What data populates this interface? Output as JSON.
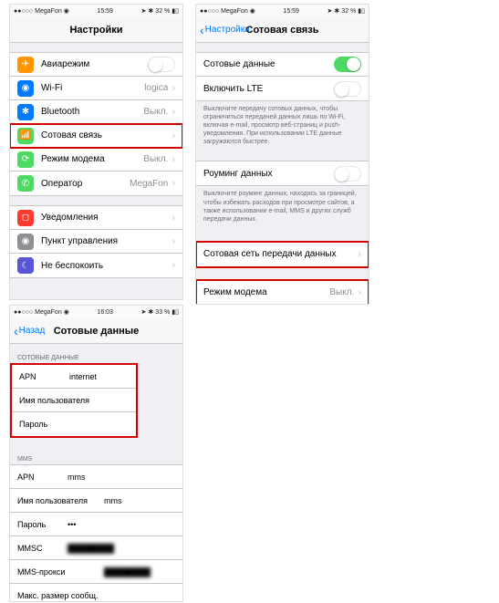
{
  "status": {
    "carrier": "MegaFon",
    "wifi": "⋮",
    "time1": "15:59",
    "time2": "15:59",
    "time3": "16:03",
    "loc": "➤",
    "bt": "✱",
    "batt1": "32 %",
    "batt2": "32 %",
    "batt3": "33 %"
  },
  "screen1": {
    "title": "Настройки",
    "rows": {
      "airplane": "Авиарежим",
      "wifi": "Wi-Fi",
      "wifi_val": "logica",
      "bluetooth": "Bluetooth",
      "bluetooth_val": "Выкл.",
      "cellular": "Сотовая связь",
      "hotspot": "Режим модема",
      "hotspot_val": "Выкл.",
      "carrier": "Оператор",
      "carrier_val": "MegaFon",
      "notif": "Уведомления",
      "control": "Пункт управления",
      "dnd": "Не беспокоить"
    }
  },
  "screen2": {
    "back": "Настройки",
    "title": "Сотовая связь",
    "cellular_data": "Сотовые данные",
    "lte": "Включить LTE",
    "note1": "Выключите передачу сотовых данных, чтобы ограничиться передачей данных лишь по Wi-Fi, включая e-mail, просмотр веб-страниц и push-уведомления. При использовании LTE данные загружаются быстрее.",
    "roaming": "Роуминг данных",
    "note2": "Выключите роуминг данных, находясь за границей, чтобы избежать расходов при просмотре сайтов, а также использовании e-mail, MMS и других служб передачи данных.",
    "apn_settings": "Сотовая сеть передачи данных",
    "hotspot": "Режим модема",
    "hotspot_val": "Выкл."
  },
  "screen3": {
    "back": "Назад",
    "title": "Сотовые данные",
    "sec1": "СОТОВЫЕ ДАННЫЕ",
    "apn": "APN",
    "apn_val": "internet",
    "user": "Имя пользователя",
    "pass": "Пароль",
    "sec2": "MMS",
    "mms_apn_val": "mms",
    "mms_user_val": "mms",
    "mms_pass_val": "•••",
    "mmsc": "MMSC",
    "mmsc_val": "████████",
    "proxy": "MMS-прокси",
    "proxy_val": "████████",
    "maxsize": "Макс. размер сообщ."
  }
}
